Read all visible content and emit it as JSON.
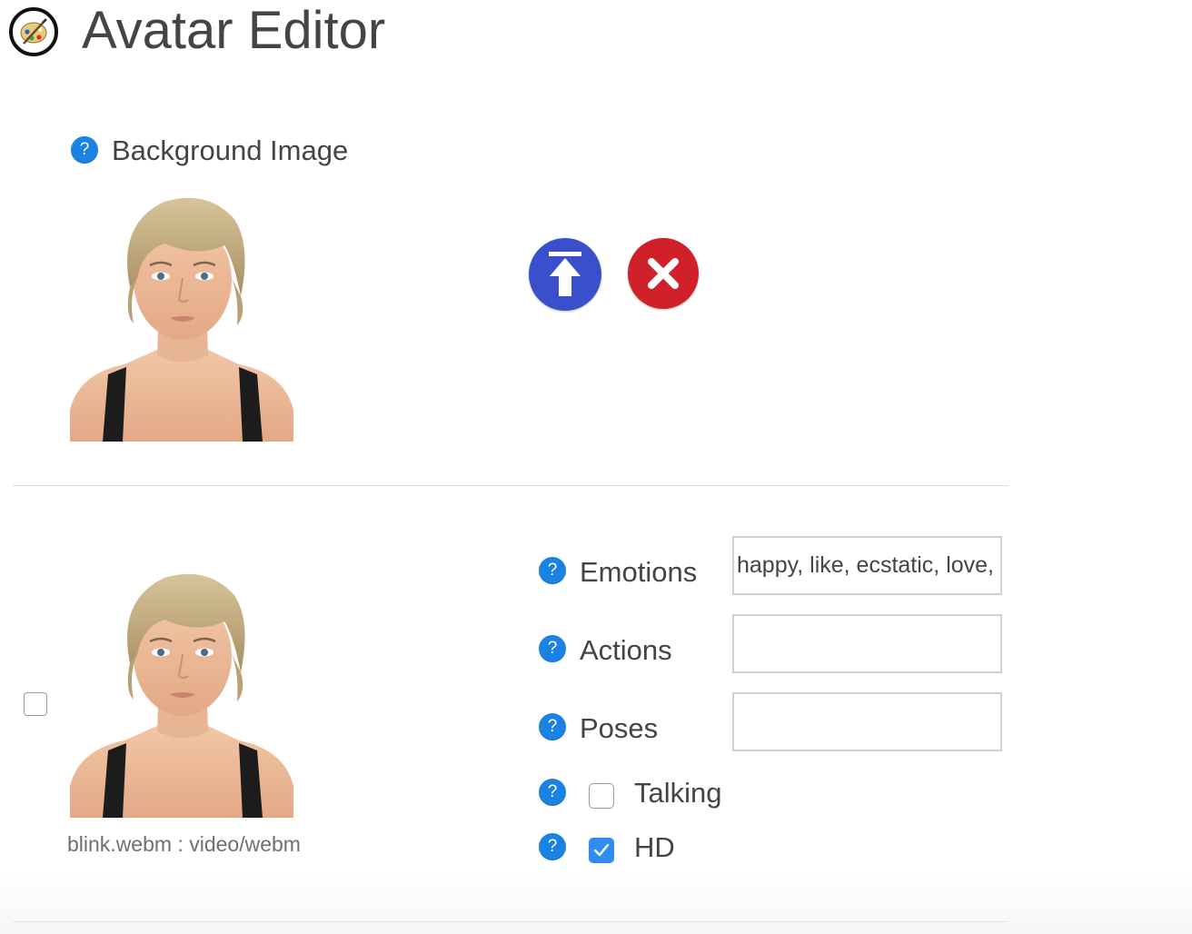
{
  "header": {
    "title": "Avatar Editor",
    "logo_icon": "paint-palette-icon"
  },
  "background_section": {
    "label": "Background Image",
    "help_icon": "?",
    "upload_icon": "upload-icon",
    "delete_icon": "close-icon"
  },
  "media_item": {
    "caption": "blink.webm : video/webm",
    "selected": false,
    "fields": {
      "emotions": {
        "label": "Emotions",
        "help": "?",
        "value": "happy, like, ecstatic, love, "
      },
      "actions": {
        "label": "Actions",
        "help": "?",
        "value": ""
      },
      "poses": {
        "label": "Poses",
        "help": "?",
        "value": ""
      }
    },
    "talking": {
      "label": "Talking",
      "help": "?",
      "checked": false
    },
    "hd": {
      "label": "HD",
      "help": "?",
      "checked": true
    }
  },
  "colors": {
    "help_blue": "#1a82e2",
    "upload_blue": "#3a4fcc",
    "delete_red": "#d0202a",
    "check_blue": "#2f8cf0"
  }
}
